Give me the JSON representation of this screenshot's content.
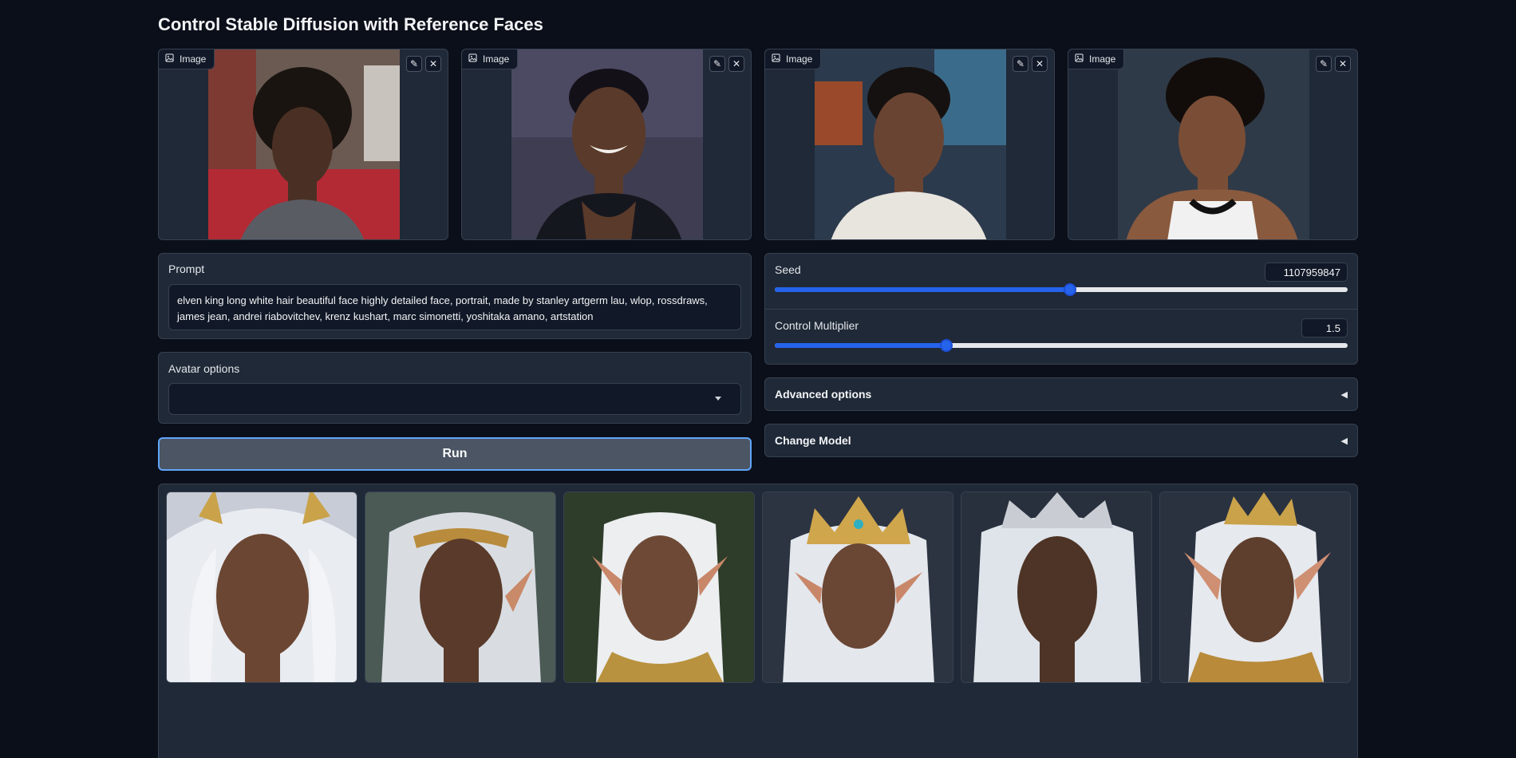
{
  "app": {
    "title": "Control Stable Diffusion with Reference Faces"
  },
  "reference_images": [
    {
      "label": "Image",
      "edit_icon": "pencil-icon",
      "close_icon": "close-icon"
    },
    {
      "label": "Image",
      "edit_icon": "pencil-icon",
      "close_icon": "close-icon"
    },
    {
      "label": "Image",
      "edit_icon": "pencil-icon",
      "close_icon": "close-icon"
    },
    {
      "label": "Image",
      "edit_icon": "pencil-icon",
      "close_icon": "close-icon"
    }
  ],
  "prompt": {
    "label": "Prompt",
    "value": "elven king long white hair beautiful face highly detailed face, portrait, made by stanley artgerm lau, wlop, rossdraws, james jean, andrei riabovitchev, krenz kushart, marc simonetti, yoshitaka amano, artstation"
  },
  "avatar_options": {
    "label": "Avatar options",
    "value": ""
  },
  "run_button": {
    "label": "Run"
  },
  "seed": {
    "label": "Seed",
    "value": "1107959847",
    "fraction": 0.515
  },
  "control_multiplier": {
    "label": "Control Multiplier",
    "value": "1.5",
    "fraction": 0.3
  },
  "advanced_options": {
    "label": "Advanced options",
    "arrow": "◀"
  },
  "change_model": {
    "label": "Change Model",
    "arrow": "◀"
  },
  "gallery": {
    "count": 6
  },
  "colors": {
    "background": "#0b0f19",
    "panel": "#1f2937",
    "accent": "#2563eb",
    "focus": "#60a5fa"
  }
}
